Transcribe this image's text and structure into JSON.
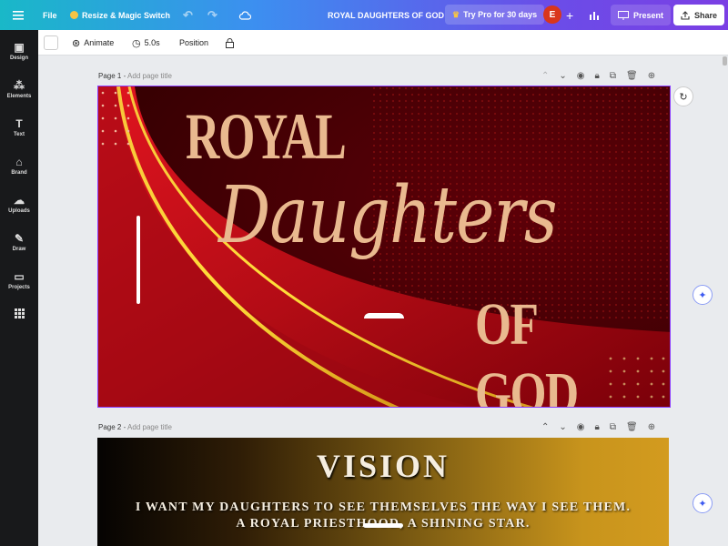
{
  "topbar": {
    "menu_icon": "menu-icon",
    "file_label": "File",
    "resize_label": "Resize & Magic Switch",
    "undo_icon": "undo-icon",
    "redo_icon": "redo-icon",
    "cloud_icon": "cloud-icon",
    "doc_title": "ROYAL DAUGHTERS OF GOD",
    "pro_label": "Try Pro for 30 days",
    "avatar_initial": "E",
    "add_icon": "plus-icon",
    "analytics_icon": "chart-icon",
    "present_label": "Present",
    "share_label": "Share"
  },
  "sidebar": {
    "items": [
      {
        "label": "Design",
        "icon": "design-icon"
      },
      {
        "label": "Elements",
        "icon": "elements-icon"
      },
      {
        "label": "Text",
        "icon": "text-icon"
      },
      {
        "label": "Brand",
        "icon": "brand-icon"
      },
      {
        "label": "Uploads",
        "icon": "upload-icon"
      },
      {
        "label": "Draw",
        "icon": "draw-icon"
      },
      {
        "label": "Projects",
        "icon": "folder-icon"
      },
      {
        "label": "",
        "icon": "apps-icon"
      }
    ]
  },
  "toolbar": {
    "animate_label": "Animate",
    "duration_label": "5.0s",
    "position_label": "Position",
    "lock_icon": "lock-icon"
  },
  "pages": [
    {
      "label": "Page 1",
      "hint": "Add page title"
    },
    {
      "label": "Page 2",
      "hint": "Add page title"
    }
  ],
  "page1": {
    "title_line1": "ROYAL",
    "title_line2": "Daughters",
    "title_line3": "OF GOD"
  },
  "page2": {
    "heading": "VISION",
    "body": "I WANT MY DAUGHTERS TO SEE THEMSELVES THE WAY I SEE THEM. A ROYAL PRIESTHOOD, A SHINING STAR."
  },
  "colors": {
    "accent": "#8b3dff",
    "title_gold": "#e9b98f",
    "page1_bg": "#4b0004",
    "ribbon_red": "#c4101a"
  }
}
